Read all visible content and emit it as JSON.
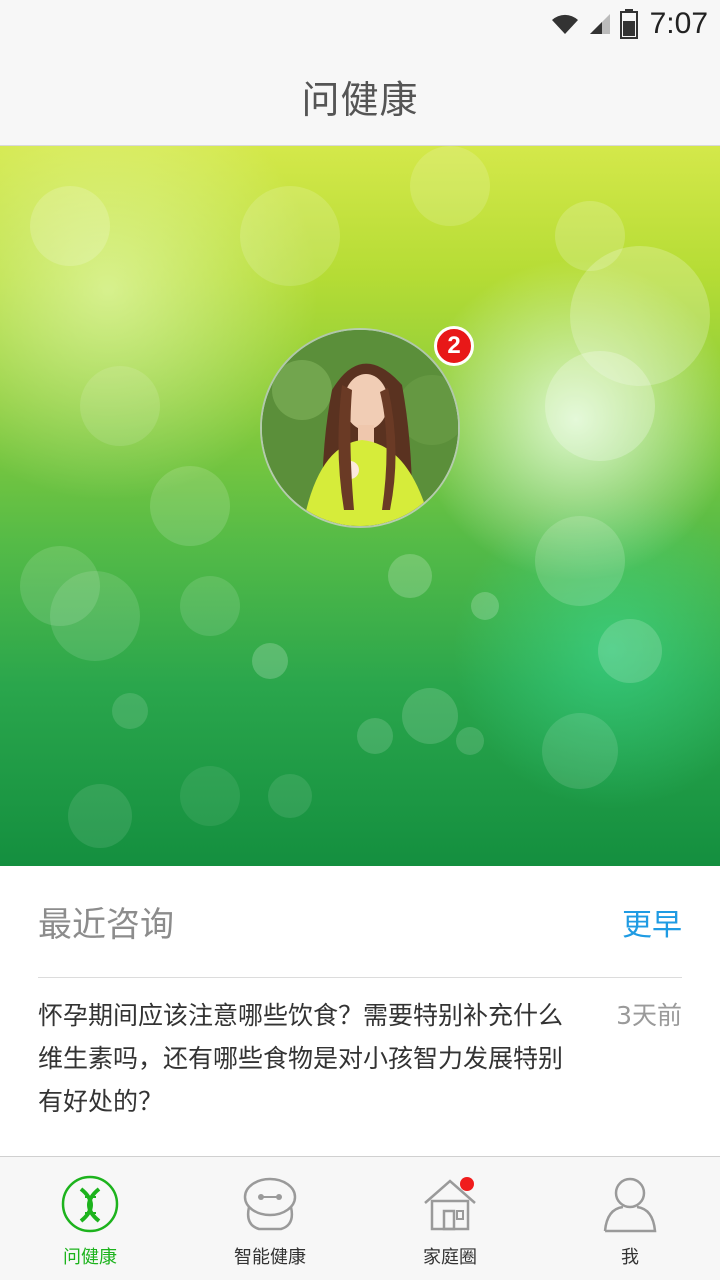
{
  "status_bar": {
    "time": "7:07"
  },
  "header": {
    "title": "问健康"
  },
  "hero": {
    "badge_count": "2"
  },
  "recent": {
    "title": "最近咨询",
    "more_label": "更早",
    "items": [
      {
        "question": "怀孕期间应该注意哪些饮食？需要特别补充什么维生素吗，还有哪些食物是对小孩智力发展特别有好处的？",
        "time": "3天前"
      }
    ]
  },
  "nav": {
    "items": [
      {
        "label": "问健康",
        "icon": "dna-icon",
        "active": true
      },
      {
        "label": "智能健康",
        "icon": "robot-icon",
        "active": false
      },
      {
        "label": "家庭圈",
        "icon": "home-icon",
        "active": false,
        "dot": true
      },
      {
        "label": "我",
        "icon": "person-icon",
        "active": false
      }
    ]
  },
  "colors": {
    "accent_green": "#1db31d",
    "link_blue": "#1f9be3",
    "badge_red": "#e81818"
  }
}
